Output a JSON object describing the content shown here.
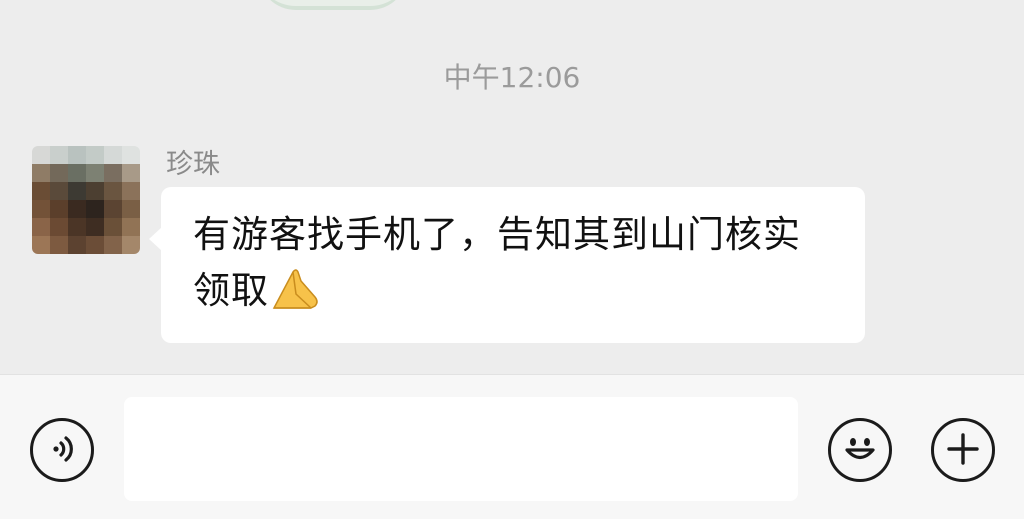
{
  "chat": {
    "timestamp": "中午12:06",
    "messages": [
      {
        "sender": "珍珠",
        "text": "有游客找手机了，告知其到山门核实领取",
        "emoji": "folded-hands-emoji"
      }
    ]
  },
  "input_bar": {
    "voice_icon": "voice-icon",
    "emoji_icon": "smiley-icon",
    "plus_icon": "plus-icon",
    "input_value": "",
    "placeholder": ""
  },
  "colors": {
    "chat_background": "#ededed",
    "bubble_background": "#ffffff",
    "input_bar_background": "#f7f7f7",
    "timestamp_text": "#9b9b9b",
    "sender_text": "#8a8a8a",
    "icon_stroke": "#1b1b1b"
  }
}
